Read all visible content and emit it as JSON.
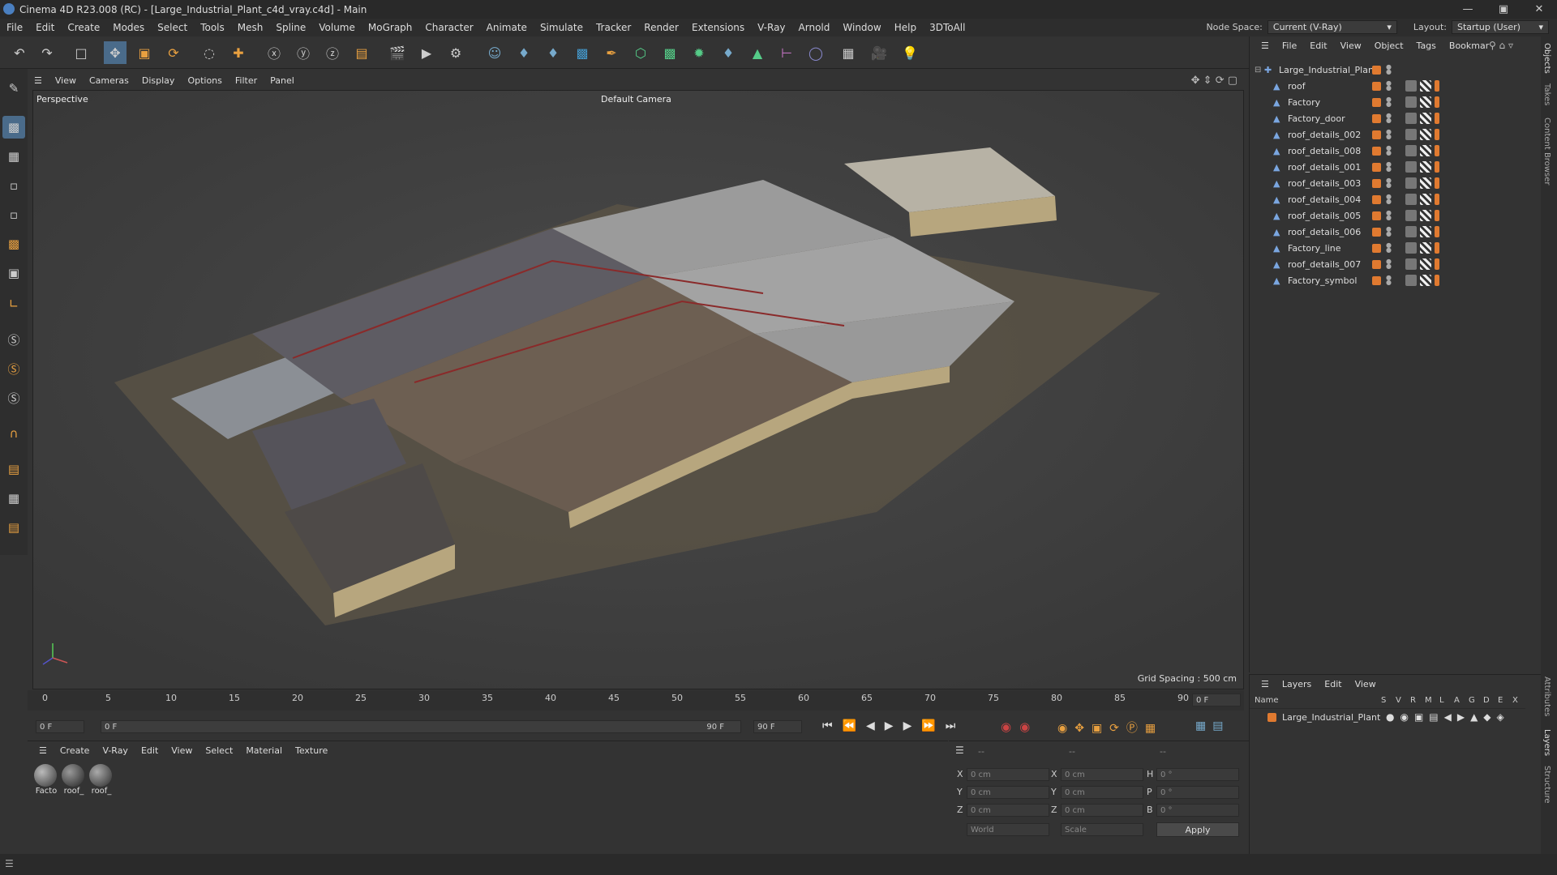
{
  "window": {
    "title": "Cinema 4D R23.008 (RC) - [Large_Industrial_Plant_c4d_vray.c4d] - Main"
  },
  "menu": [
    "File",
    "Edit",
    "Create",
    "Modes",
    "Select",
    "Tools",
    "Mesh",
    "Spline",
    "Volume",
    "MoGraph",
    "Character",
    "Animate",
    "Simulate",
    "Tracker",
    "Render",
    "Extensions",
    "V-Ray",
    "Arnold",
    "Window",
    "Help",
    "3DToAll"
  ],
  "node_space": {
    "label": "Node Space:",
    "value": "Current (V-Ray)"
  },
  "layout": {
    "label": "Layout:",
    "value": "Startup (User)"
  },
  "viewport_menu": [
    "View",
    "Cameras",
    "Display",
    "Options",
    "Filter",
    "Panel"
  ],
  "viewport": {
    "view_name": "Perspective",
    "camera": "Default Camera",
    "grid_spacing": "Grid Spacing : 500 cm"
  },
  "timeline": {
    "ticks": [
      "0",
      "5",
      "10",
      "15",
      "20",
      "25",
      "30",
      "35",
      "40",
      "45",
      "50",
      "55",
      "60",
      "65",
      "70",
      "75",
      "80",
      "85",
      "90"
    ],
    "current_frame": "0 F"
  },
  "transport": {
    "start": "0 F",
    "range_start": "0 F",
    "range_end": "90 F",
    "end": "90 F"
  },
  "material_menu": [
    "Create",
    "V-Ray",
    "Edit",
    "View",
    "Select",
    "Material",
    "Texture"
  ],
  "materials": [
    {
      "name": "Facto"
    },
    {
      "name": "roof_"
    },
    {
      "name": "roof_"
    }
  ],
  "coords": {
    "header": [
      "--",
      "--",
      "--"
    ],
    "rows": [
      {
        "axis": "X",
        "pos": "0 cm",
        "axis2": "X",
        "size": "0 cm",
        "rot_axis": "H",
        "rot": "0 °"
      },
      {
        "axis": "Y",
        "pos": "0 cm",
        "axis2": "Y",
        "size": "0 cm",
        "rot_axis": "P",
        "rot": "0 °"
      },
      {
        "axis": "Z",
        "pos": "0 cm",
        "axis2": "Z",
        "size": "0 cm",
        "rot_axis": "B",
        "rot": "0 °"
      }
    ],
    "space": "World",
    "mode": "Scale",
    "apply": "Apply"
  },
  "objects_menu": [
    "File",
    "Edit",
    "View",
    "Object",
    "Tags",
    "Bookmar"
  ],
  "objects": [
    {
      "name": "Large_Industrial_Plant"
    },
    {
      "name": "roof"
    },
    {
      "name": "Factory"
    },
    {
      "name": "Factory_door"
    },
    {
      "name": "roof_details_002"
    },
    {
      "name": "roof_details_008"
    },
    {
      "name": "roof_details_001"
    },
    {
      "name": "roof_details_003"
    },
    {
      "name": "roof_details_004"
    },
    {
      "name": "roof_details_005"
    },
    {
      "name": "roof_details_006"
    },
    {
      "name": "Factory_line"
    },
    {
      "name": "roof_details_007"
    },
    {
      "name": "Factory_symbol"
    }
  ],
  "layers_menu": [
    "Layers",
    "Edit",
    "View"
  ],
  "layers_header": {
    "name": "Name",
    "cols": [
      "S",
      "V",
      "R",
      "M",
      "L",
      "A",
      "G",
      "D",
      "E",
      "X"
    ]
  },
  "layers": [
    {
      "name": "Large_Industrial_Plant"
    }
  ],
  "side_tabs": [
    "Objects",
    "Takes",
    "Content Browser",
    "Attributes",
    "Layers",
    "Structure"
  ],
  "colors": {
    "accent": "#e07a30",
    "selected": "#4a6b8a",
    "viewport_bg": "#3f3f3f"
  }
}
